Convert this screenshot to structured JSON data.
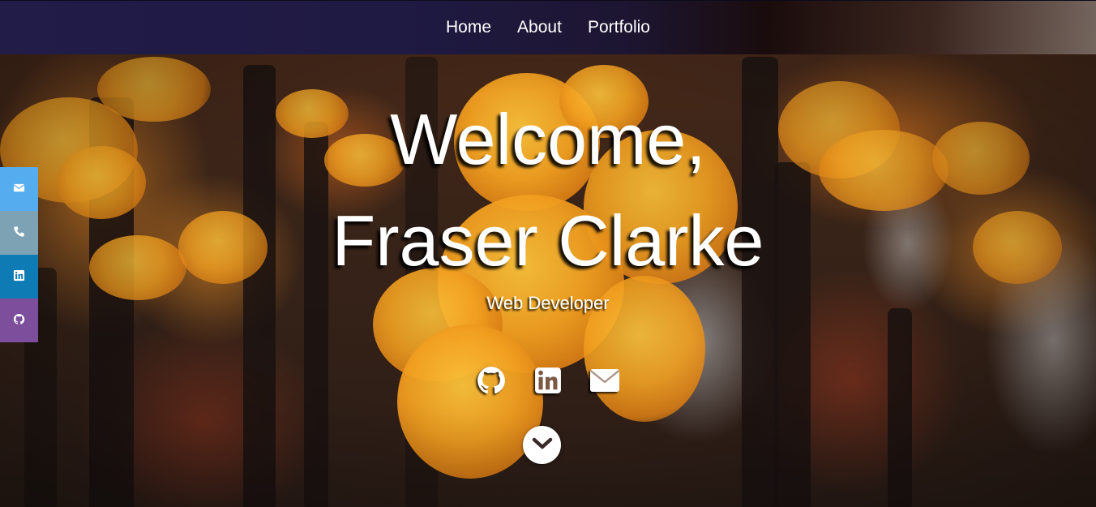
{
  "nav": {
    "items": [
      {
        "label": "Home"
      },
      {
        "label": "About"
      },
      {
        "label": "Portfolio"
      }
    ]
  },
  "hero": {
    "title_line1": "Welcome,",
    "title_line2": "Fraser Clarke",
    "subtitle": "Web Developer"
  },
  "sidebar": {
    "items": [
      {
        "icon": "envelope-icon",
        "color": "#55acee"
      },
      {
        "icon": "phone-icon",
        "color": "#7da2b3"
      },
      {
        "icon": "linkedin-icon",
        "color": "#0e7bb5"
      },
      {
        "icon": "github-icon",
        "color": "#7c4e9c"
      }
    ]
  },
  "social": {
    "items": [
      {
        "icon": "github-icon"
      },
      {
        "icon": "linkedin-icon"
      },
      {
        "icon": "envelope-icon"
      }
    ]
  },
  "scroll_button": {
    "icon": "chevron-down-icon"
  },
  "colors": {
    "nav_bg": "#211c48",
    "text": "#ffffff"
  }
}
